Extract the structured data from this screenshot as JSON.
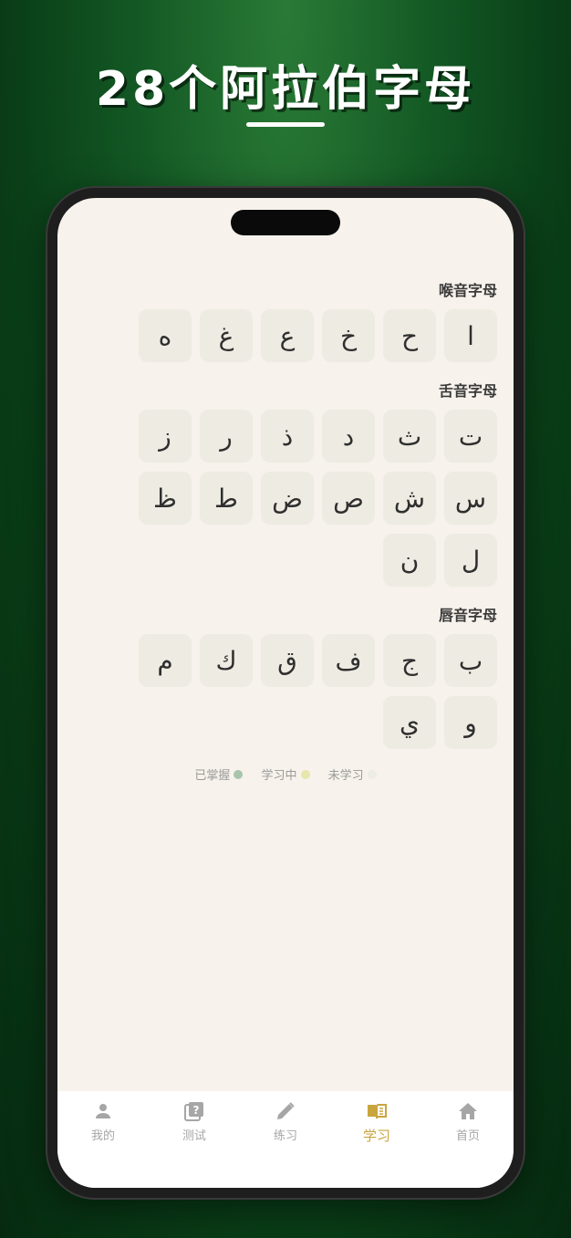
{
  "headline": "28个阿拉伯字母",
  "sections": [
    {
      "title": "喉音字母",
      "letters": [
        "ا",
        "ح",
        "خ",
        "ع",
        "غ",
        "ه"
      ]
    },
    {
      "title": "舌音字母",
      "letters": [
        "ت",
        "ث",
        "د",
        "ذ",
        "ر",
        "ز",
        "س",
        "ش",
        "ص",
        "ض",
        "ط",
        "ظ",
        "ل",
        "ن"
      ]
    },
    {
      "title": "唇音字母",
      "letters": [
        "ب",
        "ج",
        "ف",
        "ق",
        "ك",
        "م",
        "و",
        "ي"
      ]
    }
  ],
  "legend": [
    {
      "label": "已掌握",
      "color": "#a9c4ad"
    },
    {
      "label": "学习中",
      "color": "#e6e6ad"
    },
    {
      "label": "未学习",
      "color": "#eeece6"
    }
  ],
  "tabs": [
    {
      "label": "我的",
      "icon": "person-icon",
      "active": false
    },
    {
      "label": "测试",
      "icon": "quiz-icon",
      "active": false
    },
    {
      "label": "练习",
      "icon": "pencil-icon",
      "active": false
    },
    {
      "label": "学习",
      "icon": "book-icon",
      "active": true
    },
    {
      "label": "首页",
      "icon": "home-icon",
      "active": false
    }
  ],
  "colors": {
    "accent": "#c9a53e",
    "tile": "#edebe2",
    "screen": "#f7f2eb"
  }
}
